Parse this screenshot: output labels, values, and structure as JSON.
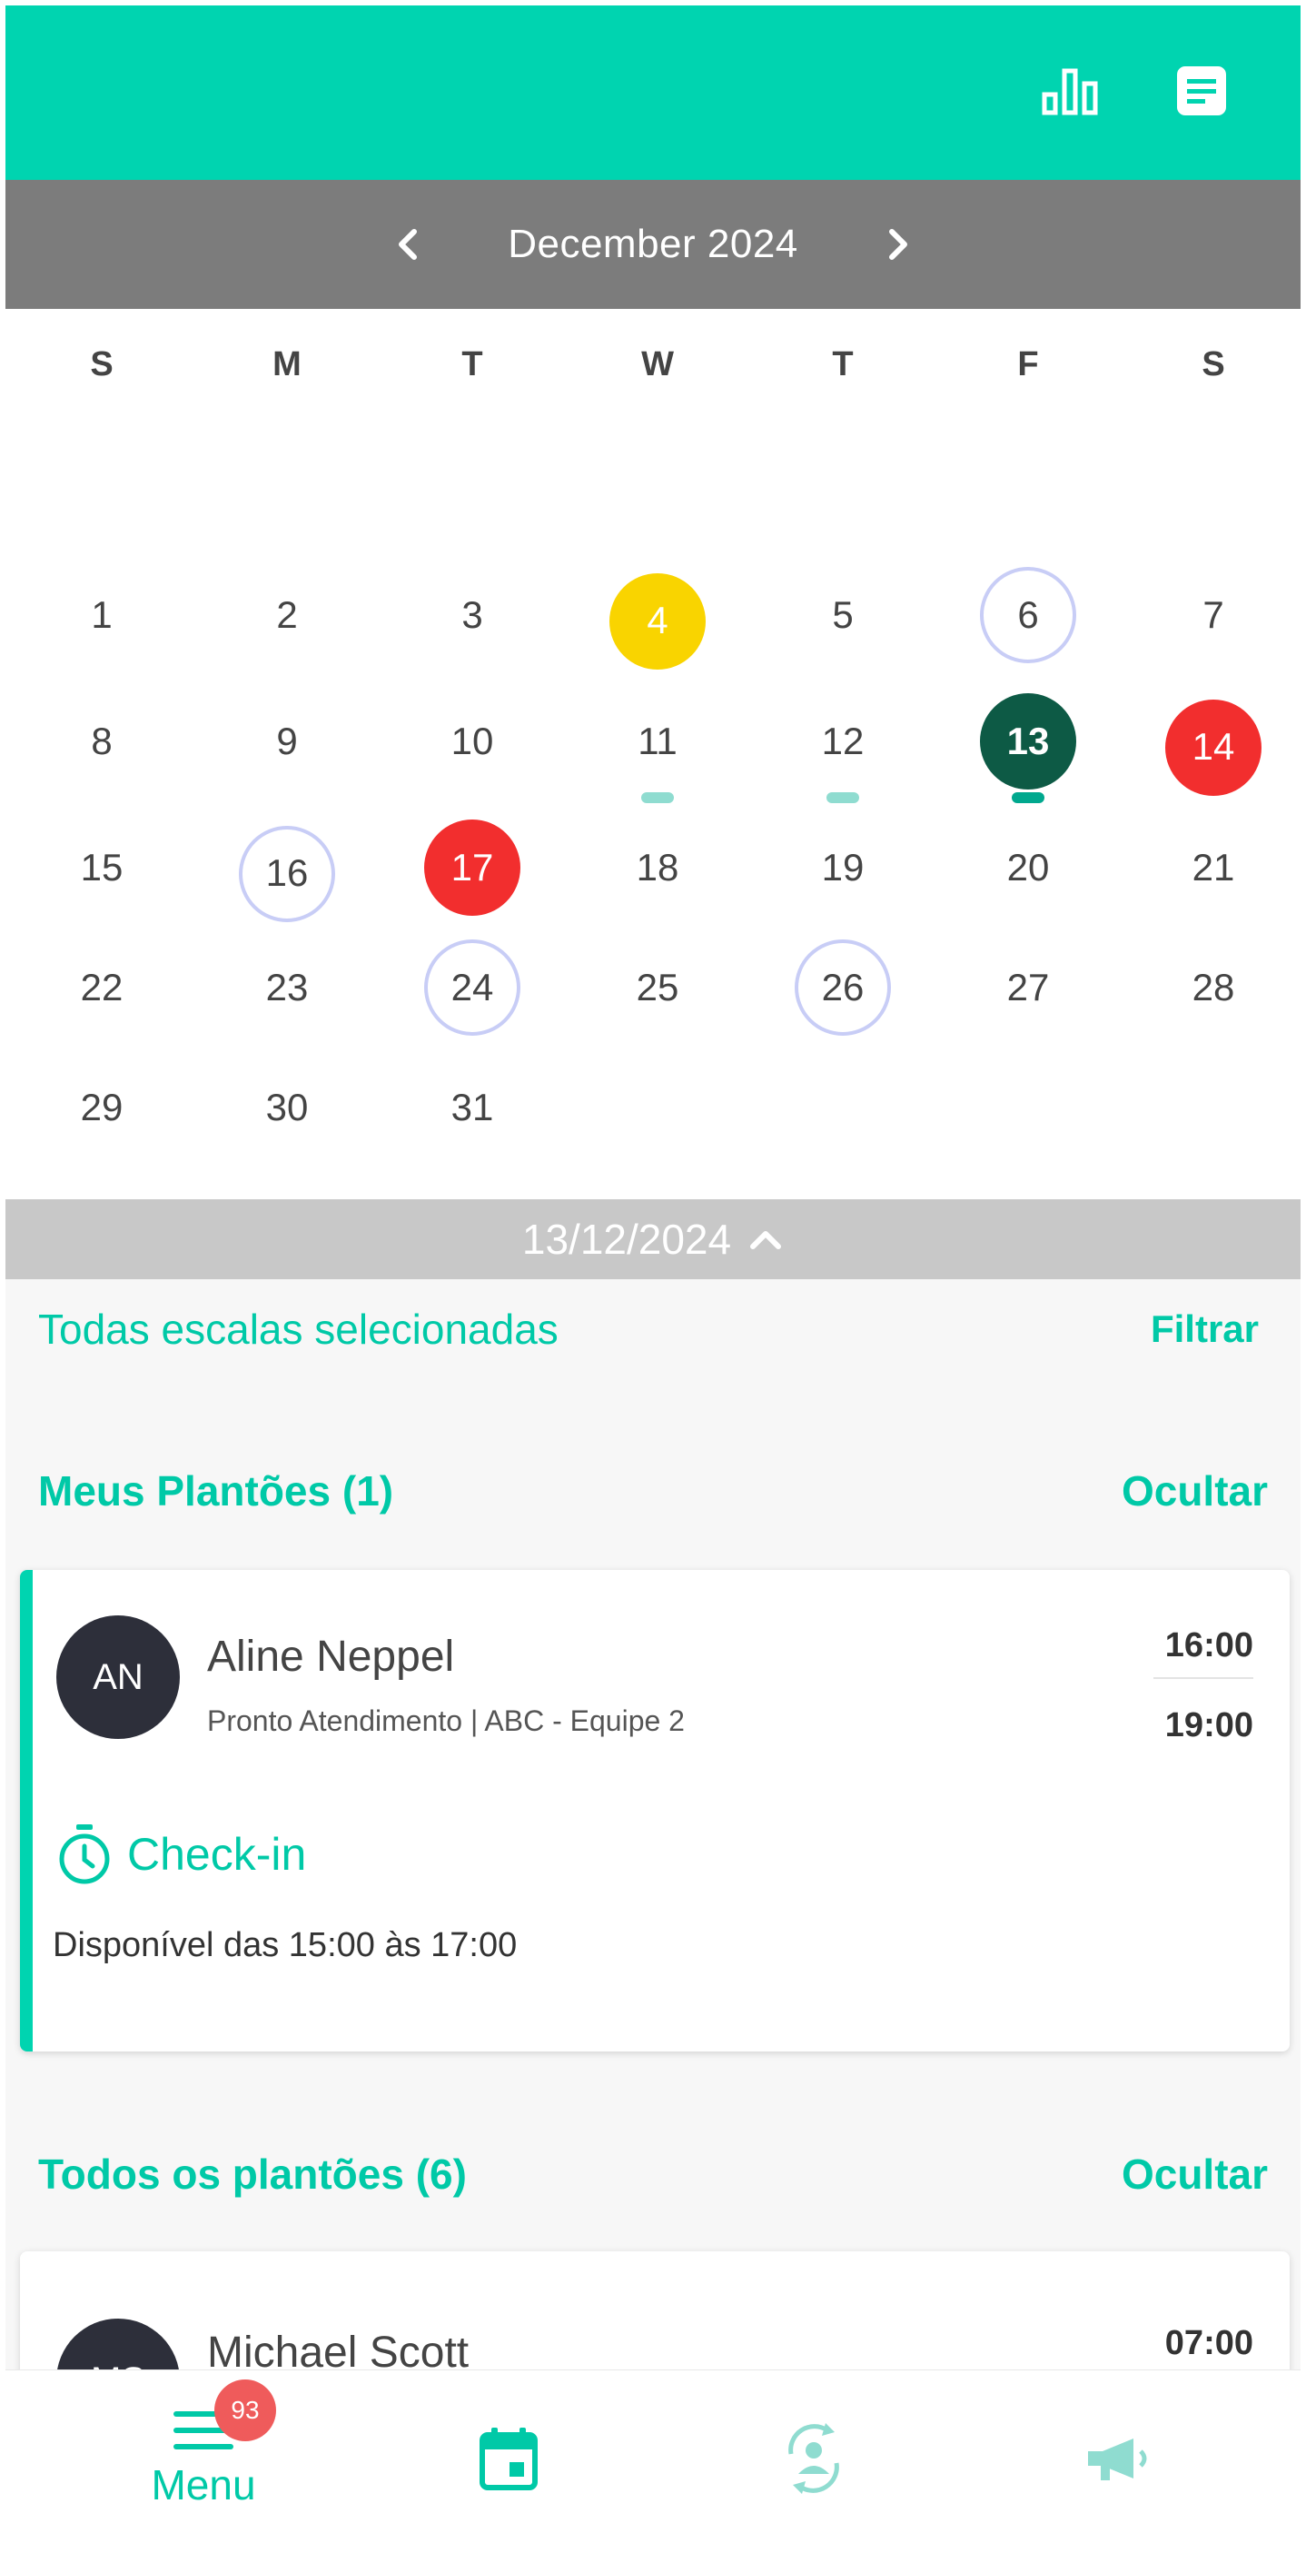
{
  "header": {
    "stats_icon": "bar-chart-icon",
    "notes_icon": "notes-icon"
  },
  "calendar": {
    "month_label": "December 2024",
    "weekdays": [
      "S",
      "M",
      "T",
      "W",
      "T",
      "F",
      "S"
    ],
    "days": [
      "1",
      "2",
      "3",
      "4",
      "5",
      "6",
      "7",
      "8",
      "9",
      "10",
      "11",
      "12",
      "13",
      "14",
      "15",
      "16",
      "17",
      "18",
      "19",
      "20",
      "21",
      "22",
      "23",
      "24",
      "25",
      "26",
      "27",
      "28",
      "29",
      "30",
      "31"
    ],
    "highlight_colors": {
      "yellow": "#f9d400",
      "red": "#f22e2e",
      "selected": "#0d5a45",
      "ring": "#c8cdf6"
    }
  },
  "selected_date": "13/12/2024",
  "filter": {
    "text": "Todas escalas selecionadas",
    "button": "Filtrar"
  },
  "my_shifts": {
    "title": "Meus Plantões (1)",
    "toggle": "Ocultar",
    "card": {
      "initials": "AN",
      "name": "Aline Neppel",
      "detail": "Pronto Atendimento | ABC - Equipe 2",
      "start": "16:00",
      "end": "19:00",
      "checkin_label": "Check-in",
      "availability": "Disponível das 15:00 às 17:00"
    }
  },
  "all_shifts": {
    "title": "Todos os plantões (6)",
    "toggle": "Ocultar",
    "card": {
      "initials": "MS",
      "name": "Michael Scott",
      "start": "07:00"
    }
  },
  "bottom_nav": {
    "menu_label": "Menu",
    "badge": "93"
  },
  "colors": {
    "primary": "#00d4b0",
    "accent_text": "#00c9a7",
    "month_bar": "#7c7c7c"
  }
}
